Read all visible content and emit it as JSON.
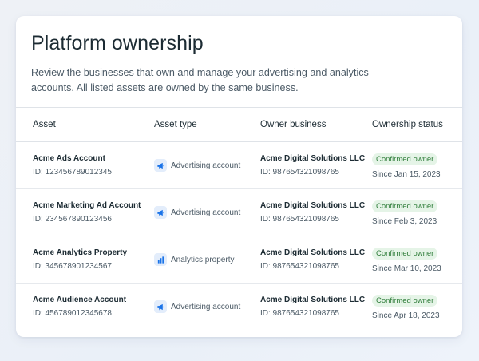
{
  "page": {
    "title": "Platform ownership",
    "description": "Review the businesses that own and manage your advertising and analytics accounts. All listed assets are owned by the same business."
  },
  "table": {
    "headers": {
      "asset": "Asset",
      "asset_type": "Asset type",
      "owner_business": "Owner business",
      "ownership_status": "Ownership status"
    },
    "rows": [
      {
        "name": "Acme Ads Account",
        "id": "ID: 123456789012345",
        "type": "Advertising account",
        "type_icon": "megaphone-icon",
        "owner": "Acme Digital Solutions LLC",
        "owner_id": "ID: 987654321098765",
        "status": "Confirmed owner",
        "since": "Since Jan 15, 2023"
      },
      {
        "name": "Acme Marketing Ad Account",
        "id": "ID: 234567890123456",
        "type": "Advertising account",
        "type_icon": "megaphone-icon",
        "owner": "Acme Digital Solutions LLC",
        "owner_id": "ID: 987654321098765",
        "status": "Confirmed owner",
        "since": "Since Feb 3, 2023"
      },
      {
        "name": "Acme Analytics Property",
        "id": "ID: 345678901234567",
        "type": "Analytics property",
        "type_icon": "bar-chart-icon",
        "owner": "Acme Digital Solutions LLC",
        "owner_id": "ID: 987654321098765",
        "status": "Confirmed owner",
        "since": "Since Mar 10, 2023"
      },
      {
        "name": "Acme Audience Account",
        "id": "ID: 456789012345678",
        "type": "Advertising account",
        "type_icon": "megaphone-icon",
        "owner": "Acme Digital Solutions LLC",
        "owner_id": "ID: 987654321098765",
        "status": "Confirmed owner",
        "since": "Since Apr 18, 2023"
      }
    ]
  },
  "colors": {
    "accent_icon": "#1a73e8",
    "badge_bg": "#e5f4e7",
    "badge_text": "#2f7d3a",
    "text_primary": "#1c2b33",
    "text_secondary": "#4b5a66"
  }
}
